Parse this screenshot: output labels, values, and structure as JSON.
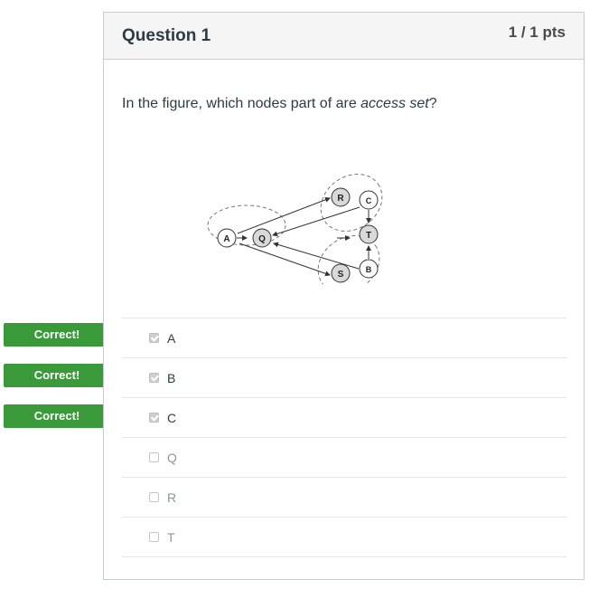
{
  "question": {
    "title": "Question 1",
    "points": "1 / 1 pts",
    "text_prefix": "In the figure, which nodes part of are ",
    "text_emphasis": "access set",
    "text_suffix": "?"
  },
  "figure": {
    "nodes": [
      "A",
      "Q",
      "R",
      "C",
      "T",
      "B",
      "S"
    ]
  },
  "correct_label": "Correct!",
  "answers": [
    {
      "label": "A",
      "checked": true,
      "correct": true
    },
    {
      "label": "B",
      "checked": true,
      "correct": true
    },
    {
      "label": "C",
      "checked": true,
      "correct": true
    },
    {
      "label": "Q",
      "checked": false,
      "correct": false
    },
    {
      "label": "R",
      "checked": false,
      "correct": false
    },
    {
      "label": "T",
      "checked": false,
      "correct": false
    }
  ],
  "colors": {
    "correct_flag": "#3a9a3a",
    "header_bg": "#f5f5f5",
    "border": "#c7cdd1"
  }
}
